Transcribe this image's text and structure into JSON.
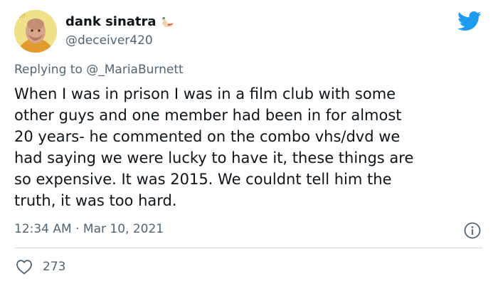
{
  "author": {
    "display_name": "dank sinatra",
    "handle": "@deceiver420",
    "avatar_badge": "GIF"
  },
  "reply": {
    "prefix": "Replying to ",
    "mention": "@_MariaBurnett"
  },
  "tweet": {
    "text": "When I was in prison I was in a film club with some\nother guys and one member had been in for almost\n20 years- he commented on the combo vhs/dvd we\nhad saying we were lucky to have it, these things are\nso expensive. It was 2015. We couldnt tell him the\ntruth, it was too hard."
  },
  "meta": {
    "time": "12:34 AM",
    "separator": " · ",
    "date": "Mar 10, 2021"
  },
  "stats": {
    "likes": "273"
  },
  "colors": {
    "twitter_blue": "#1d9bf0",
    "secondary_text": "#536471"
  },
  "icons": {
    "logo": "twitter-bird-icon",
    "info": "info-icon",
    "like": "heart-icon",
    "name_emoji": "duck-emoji-icon"
  }
}
